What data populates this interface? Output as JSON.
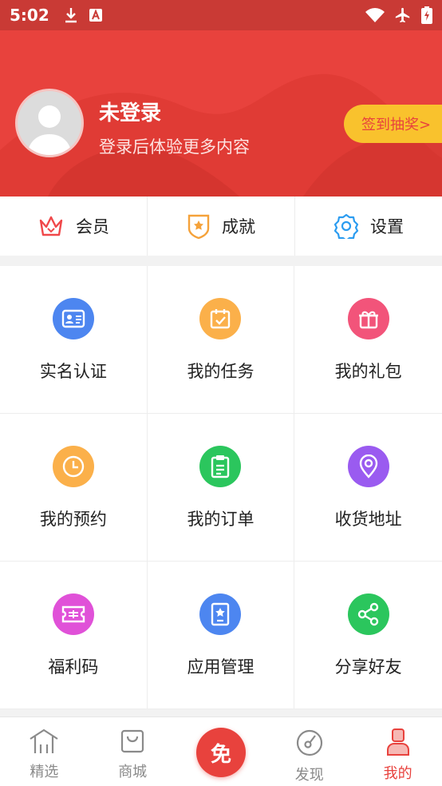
{
  "status": {
    "time": "5:02"
  },
  "profile": {
    "username": "未登录",
    "subtitle": "登录后体验更多内容",
    "signin_label": "签到抽奖>"
  },
  "quick": [
    {
      "label": "会员",
      "icon": "crown-icon",
      "color": "#f0484a"
    },
    {
      "label": "成就",
      "icon": "badge-icon",
      "color": "#f5a23a"
    },
    {
      "label": "设置",
      "icon": "gear-icon",
      "color": "#2b9cf0"
    }
  ],
  "grid": [
    {
      "label": "实名认证",
      "icon": "id-card-icon",
      "color": "#4d86f0"
    },
    {
      "label": "我的任务",
      "icon": "task-calendar-icon",
      "color": "#fbb04a"
    },
    {
      "label": "我的礼包",
      "icon": "gift-icon",
      "color": "#f2547a"
    },
    {
      "label": "我的预约",
      "icon": "clock-icon",
      "color": "#fbb04a"
    },
    {
      "label": "我的订单",
      "icon": "clipboard-icon",
      "color": "#2bc65d"
    },
    {
      "label": "收货地址",
      "icon": "location-pin-icon",
      "color": "#9a5bf0"
    },
    {
      "label": "福利码",
      "icon": "ticket-icon",
      "color": "#e051d8"
    },
    {
      "label": "应用管理",
      "icon": "app-manage-icon",
      "color": "#4d86f0"
    },
    {
      "label": "分享好友",
      "icon": "share-icon",
      "color": "#2bc65d"
    }
  ],
  "tabs": [
    {
      "label": "精选",
      "icon": "home-icon",
      "active": false
    },
    {
      "label": "商城",
      "icon": "shopping-bag-icon",
      "active": false
    },
    {
      "label": "",
      "icon": "free-icon",
      "active": false
    },
    {
      "label": "发现",
      "icon": "compass-icon",
      "active": false
    },
    {
      "label": "我的",
      "icon": "profile-icon",
      "active": true
    }
  ],
  "center_tab_label": "免"
}
